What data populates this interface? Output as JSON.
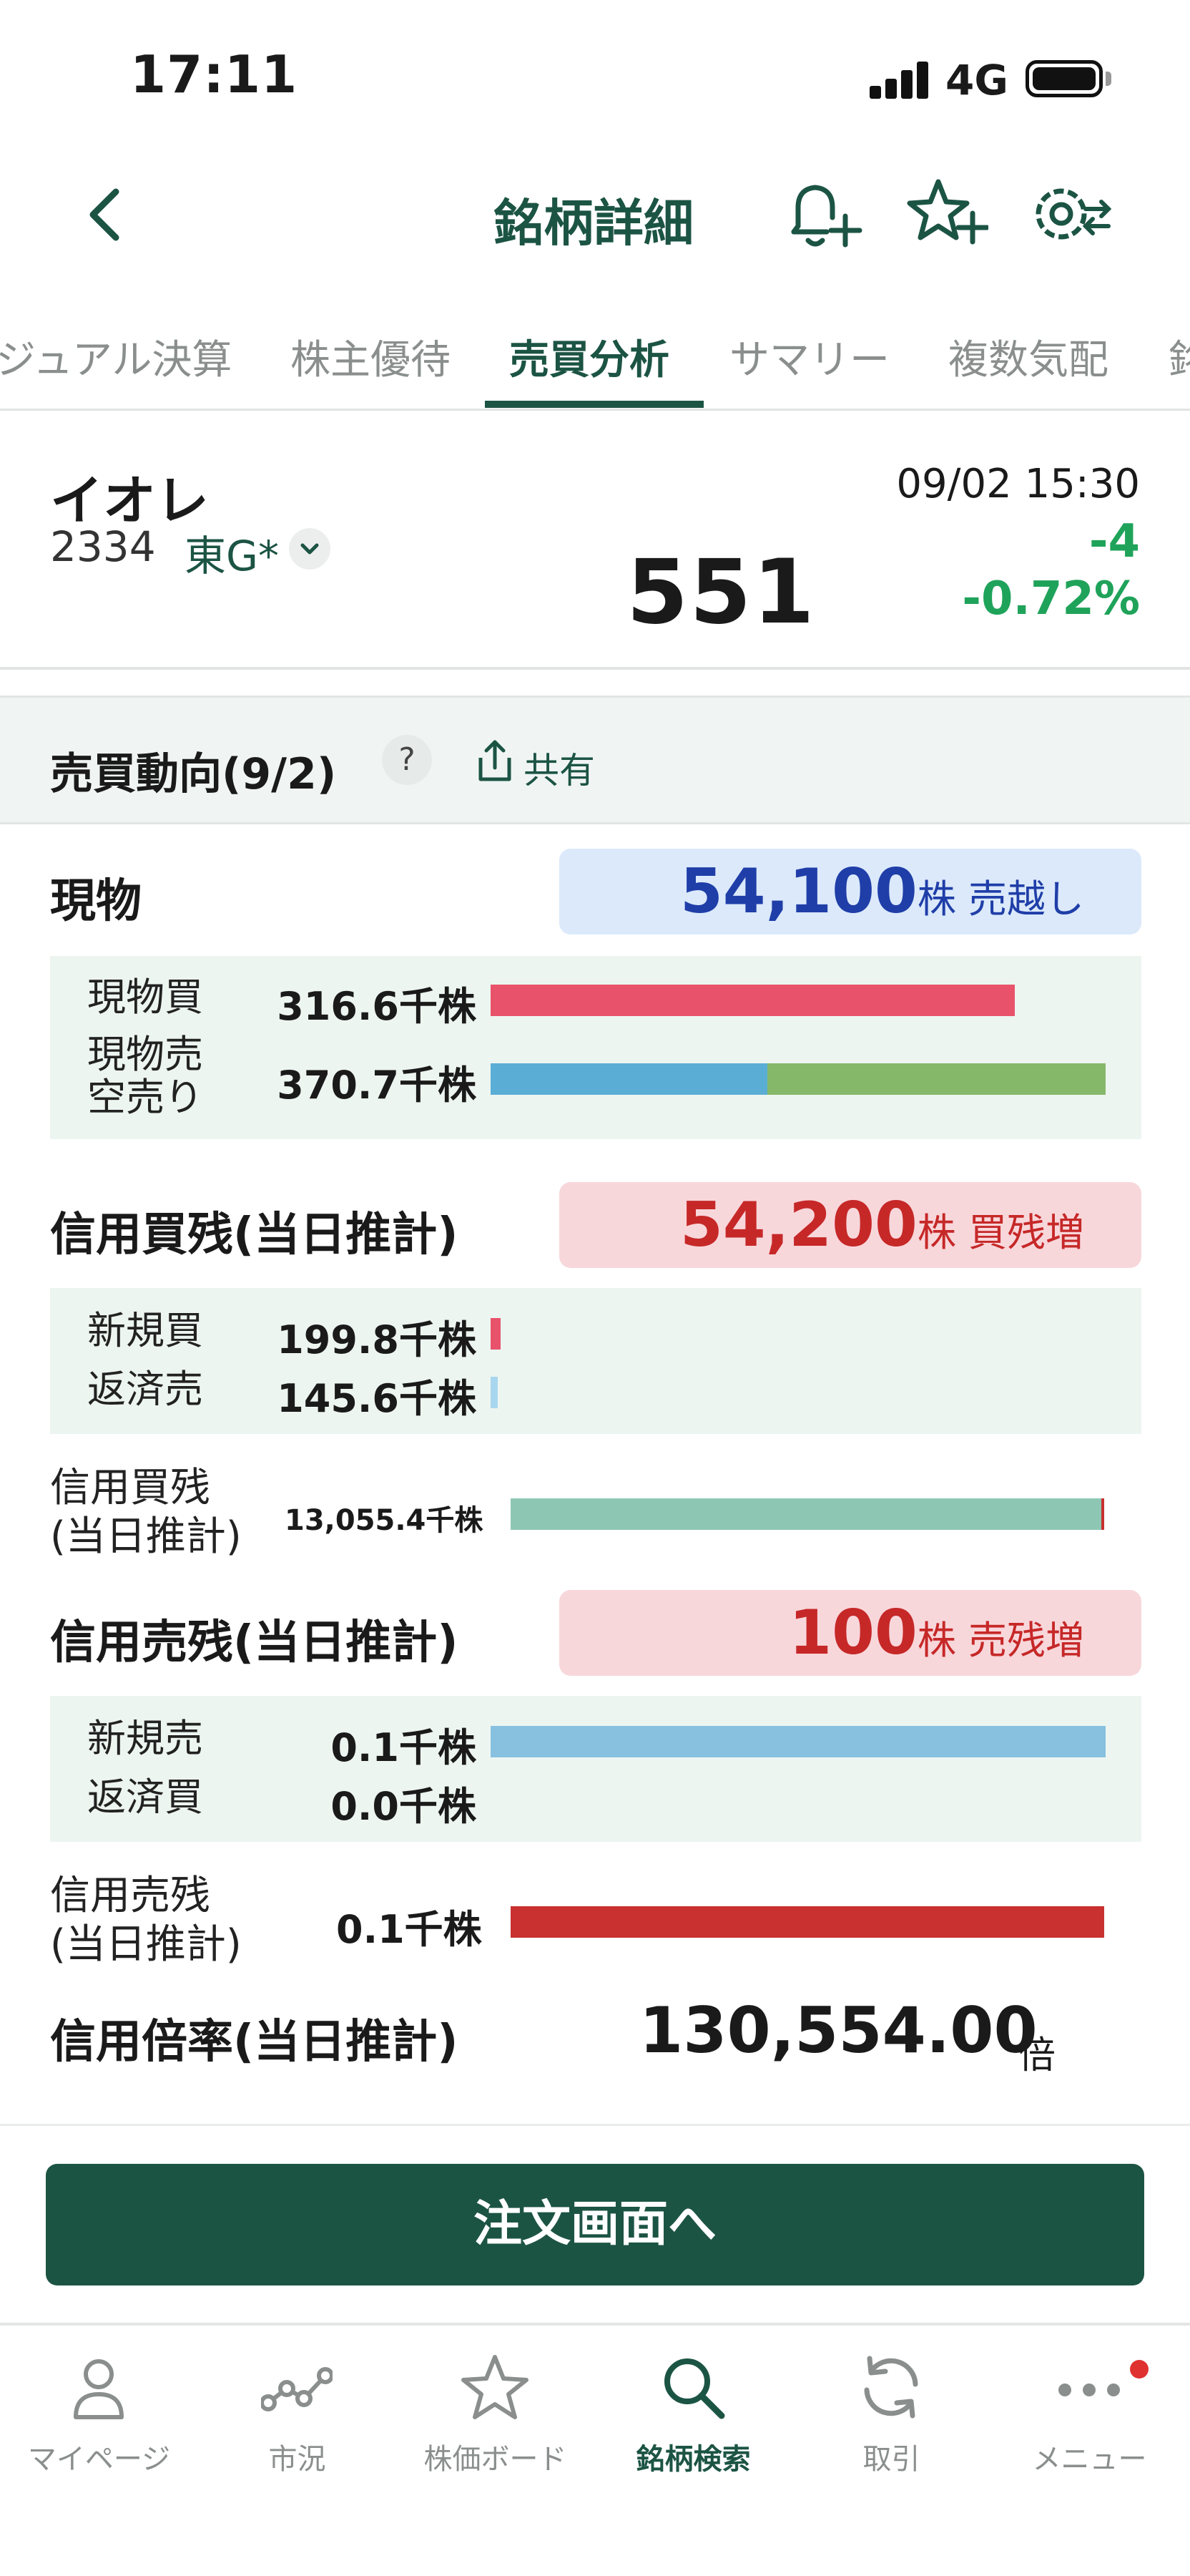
{
  "status_bar": {
    "time": "17:11",
    "network": "4G"
  },
  "header": {
    "title": "銘柄詳細",
    "icons": [
      "back-arrow-icon",
      "bell-plus-icon",
      "star-plus-icon",
      "gear-swap-icon"
    ]
  },
  "tabs": [
    {
      "label": "ジュアル決算",
      "active": false
    },
    {
      "label": "株主優待",
      "active": false
    },
    {
      "label": "売買分析",
      "active": true
    },
    {
      "label": "サマリー",
      "active": false
    },
    {
      "label": "複数気配",
      "active": false
    },
    {
      "label": "銘",
      "active": false
    }
  ],
  "stock": {
    "name": "イオレ",
    "code": "2334",
    "market": "東G*",
    "price": "551",
    "timestamp": "09/02 15:30",
    "change": "-4",
    "change_pct": "-0.72%"
  },
  "section": {
    "title": "売買動向(9/2)",
    "help": "?",
    "share": "共有"
  },
  "spot": {
    "label": "現物",
    "net_value": "54,100",
    "net_unit": "株",
    "net_status": "売越し",
    "buy": {
      "label": "現物買",
      "value": "316.6千株",
      "fraction": 0.852
    },
    "sell": {
      "label_line1": "現物売",
      "label_line2": "空売り",
      "value": "370.7千株",
      "spot_fraction": 0.45,
      "short_fraction": 0.55
    }
  },
  "margin_buy": {
    "label": "信用買残(当日推計)",
    "net_value": "54,200",
    "net_unit": "株",
    "net_status": "買残増",
    "new_buy": {
      "label": "新規買",
      "value": "199.8千株"
    },
    "repay_sell": {
      "label": "返済売",
      "value": "145.6千株"
    },
    "balance": {
      "label_line1": "信用買残",
      "label_line2": "(当日推計)",
      "value": "13,055.4千株"
    }
  },
  "margin_sell": {
    "label": "信用売残(当日推計)",
    "net_value": "100",
    "net_unit": "株",
    "net_status": "売残増",
    "new_sell": {
      "label": "新規売",
      "value": "0.1千株",
      "fraction": 1.0
    },
    "repay_buy": {
      "label": "返済買",
      "value": "0.0千株",
      "fraction": 0.0
    },
    "balance": {
      "label_line1": "信用売残",
      "label_line2": "(当日推計)",
      "value": "0.1千株",
      "fraction": 1.0
    }
  },
  "ratio": {
    "label": "信用倍率(当日推計)",
    "value": "130,554.00",
    "unit": "倍"
  },
  "order_button": "注文画面へ",
  "tabbar": [
    {
      "label": "マイページ",
      "icon": "person-icon",
      "active": false
    },
    {
      "label": "市況",
      "icon": "chart-nodes-icon",
      "active": false
    },
    {
      "label": "株価ボード",
      "icon": "star-outline-icon",
      "active": false
    },
    {
      "label": "銘柄検索",
      "icon": "search-icon",
      "active": true
    },
    {
      "label": "取引",
      "icon": "refresh-icon",
      "active": false
    },
    {
      "label": "メニュー",
      "icon": "more-dots-icon",
      "active": false
    }
  ],
  "colors": {
    "brand": "#1c5444",
    "up_green": "#1fa35a",
    "spot_buy_bar": "#e8526b",
    "spot_sell_bar": "#5aaed6",
    "short_sell_bar": "#86b86a",
    "margin_balance_bar": "#8ec6b4",
    "margin_sell_bar": "#87c1df",
    "sell_balance_bar": "#c93030",
    "sell_pill_bg": "#dbe9fb",
    "buy_pill_bg": "#f8d7db"
  }
}
